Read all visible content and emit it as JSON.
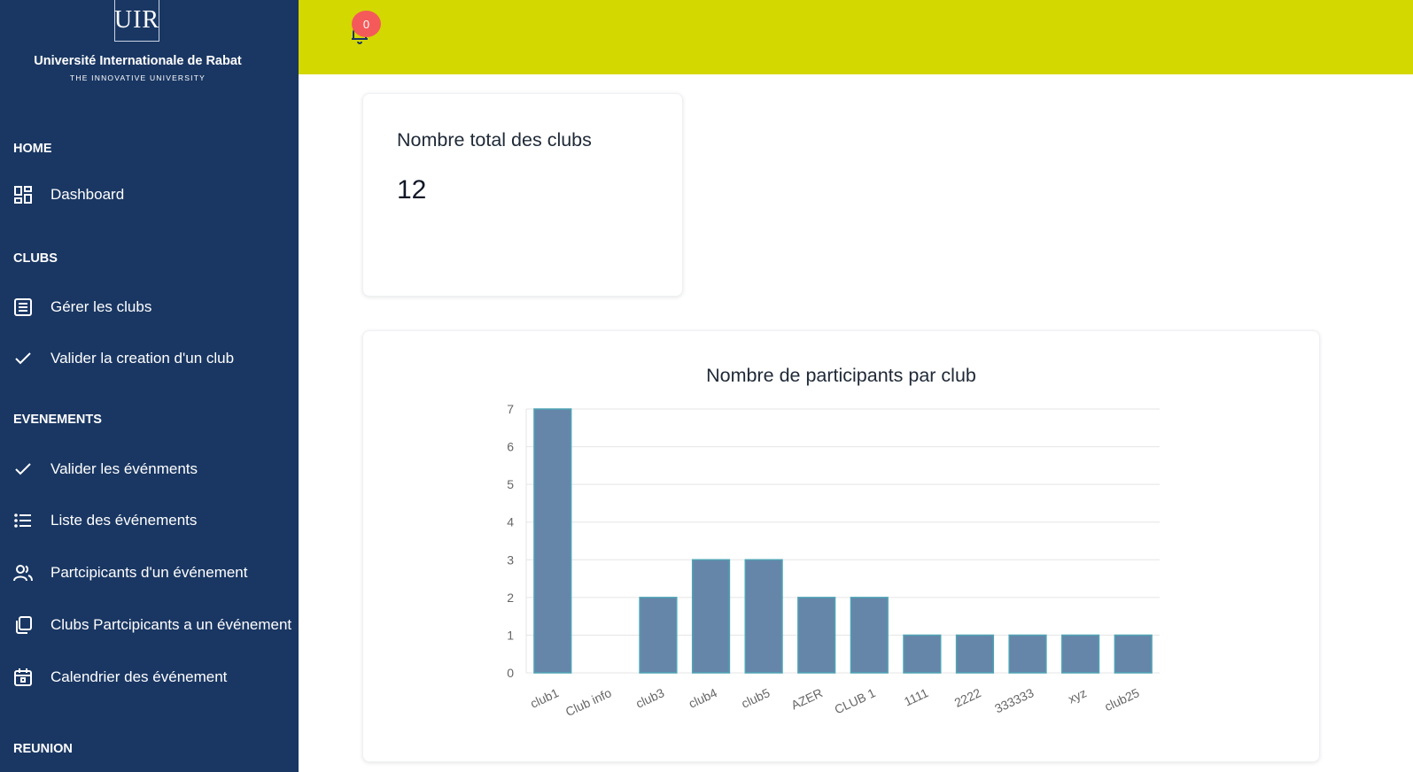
{
  "sidebar": {
    "logo_text": "UIR",
    "university_name": "Université Internationale de Rabat",
    "tagline": "THE INNOVATIVE UNIVERSITY",
    "sections": [
      {
        "title": "HOME",
        "items": [
          {
            "label": "Dashboard",
            "icon": "dashboard-icon"
          }
        ]
      },
      {
        "title": "CLUBS",
        "items": [
          {
            "label": "Gérer les clubs",
            "icon": "list-box-icon"
          },
          {
            "label": "Valider la creation d'un club",
            "icon": "check-icon"
          }
        ]
      },
      {
        "title": "EVENEMENTS",
        "items": [
          {
            "label": "Valider les événments",
            "icon": "check-icon"
          },
          {
            "label": "Liste des événements",
            "icon": "list-icon"
          },
          {
            "label": "Partcipicants d'un événement",
            "icon": "users-icon"
          },
          {
            "label": "Clubs Partcipicants a un événement",
            "icon": "copy-icon"
          },
          {
            "label": "Calendrier des événement",
            "icon": "calendar-icon"
          }
        ]
      },
      {
        "title": "REUNION",
        "items": []
      }
    ]
  },
  "header": {
    "notification_count": "0",
    "bar_color": "#d3d800"
  },
  "summary": {
    "title": "Nombre total des clubs",
    "value": "12"
  },
  "chart_data": {
    "type": "bar",
    "title": "Nombre de participants par club",
    "categories": [
      "club1",
      "Club info",
      "club3",
      "club4",
      "club5",
      "AZER",
      "CLUB 1",
      "1111",
      "2222",
      "333333",
      "xyz",
      "club25"
    ],
    "values": [
      7,
      0,
      2,
      3,
      3,
      2,
      2,
      1,
      1,
      1,
      1,
      1
    ],
    "ylim": [
      0,
      7
    ],
    "yticks": [
      0,
      1,
      2,
      3,
      4,
      5,
      6,
      7
    ],
    "bar_color": "#6586a8",
    "bar_border_color": "#4fa3b5",
    "grid": true
  }
}
